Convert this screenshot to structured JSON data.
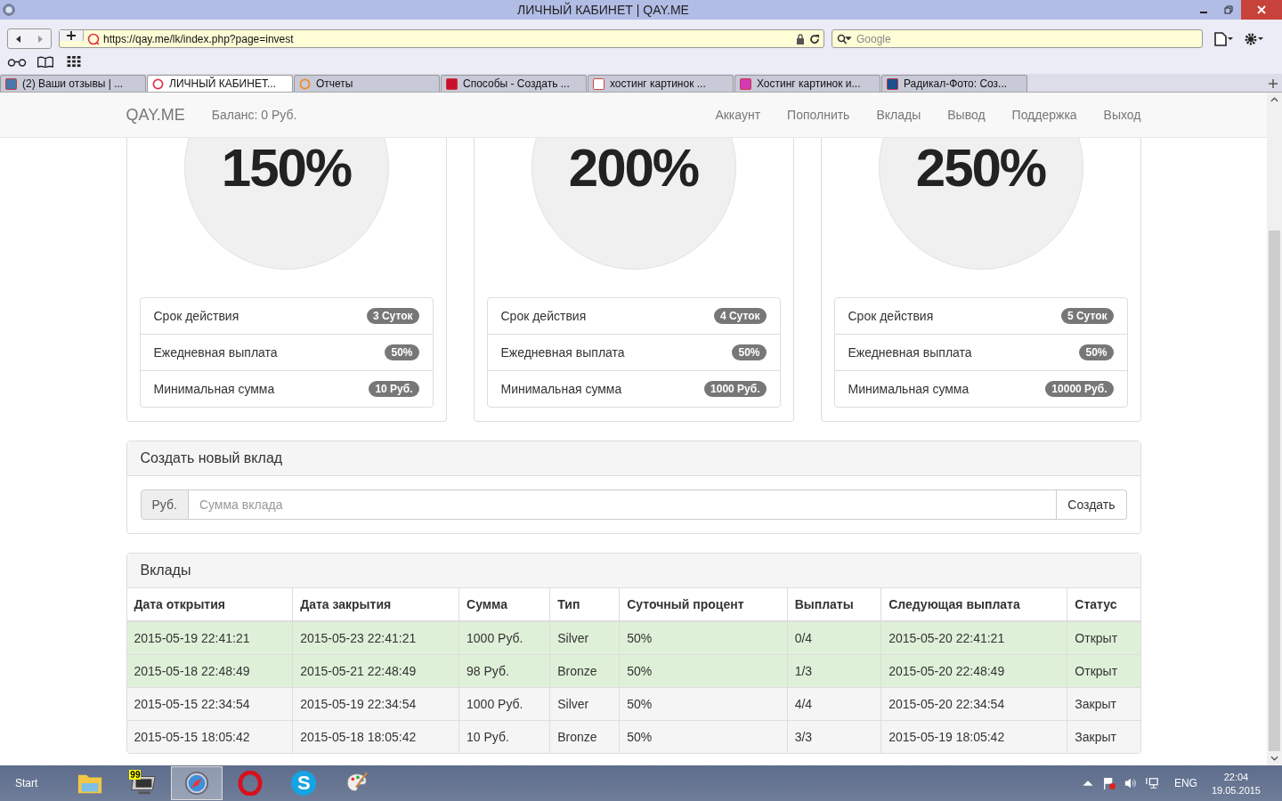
{
  "window": {
    "title": "ЛИЧНЫЙ КАБИНЕТ | QAY.ME"
  },
  "browser": {
    "address": "https://qay.me/lk/index.php?page=invest",
    "search_placeholder": "Google",
    "tabs": [
      {
        "label": "(2) Ваши отзывы | ...",
        "kind": "vk",
        "selected": false
      },
      {
        "label": "ЛИЧНЫЙ КАБИНЕТ...",
        "kind": "ring-red",
        "selected": true
      },
      {
        "label": "Отчеты",
        "kind": "ring-orange",
        "selected": false
      },
      {
        "label": "Способы - Создать ...",
        "kind": "square-red",
        "selected": false
      },
      {
        "label": "хостинг картинок ...",
        "kind": "ya",
        "selected": false
      },
      {
        "label": "Хостинг картинок и...",
        "kind": "k",
        "selected": false
      },
      {
        "label": "Радикал-Фото: Соз...",
        "kind": "r",
        "selected": false
      }
    ]
  },
  "navbar": {
    "brand": "QAY.ME",
    "balance": "Баланс: 0 Руб.",
    "links": [
      "Аккаунт",
      "Пополнить",
      "Вклады",
      "Вывод",
      "Поддержка",
      "Выход"
    ]
  },
  "plans": [
    {
      "percent": "150%",
      "rows": [
        {
          "label": "Срок действия",
          "badge": "3 Суток"
        },
        {
          "label": "Ежедневная выплата",
          "badge": "50%"
        },
        {
          "label": "Минимальная сумма",
          "badge": "10 Руб."
        }
      ]
    },
    {
      "percent": "200%",
      "rows": [
        {
          "label": "Срок действия",
          "badge": "4 Суток"
        },
        {
          "label": "Ежедневная выплата",
          "badge": "50%"
        },
        {
          "label": "Минимальная сумма",
          "badge": "1000 Руб."
        }
      ]
    },
    {
      "percent": "250%",
      "rows": [
        {
          "label": "Срок действия",
          "badge": "5 Суток"
        },
        {
          "label": "Ежедневная выплата",
          "badge": "50%"
        },
        {
          "label": "Минимальная сумма",
          "badge": "10000 Руб."
        }
      ]
    }
  ],
  "new_deposit": {
    "title": "Создать новый вклад",
    "addon": "Руб.",
    "placeholder": "Сумма вклада",
    "button": "Создать"
  },
  "deposits": {
    "title": "Вклады",
    "columns": [
      "Дата открытия",
      "Дата закрытия",
      "Сумма",
      "Тип",
      "Суточный процент",
      "Выплаты",
      "Следующая выплата",
      "Статус"
    ],
    "rows": [
      {
        "highlighted": true,
        "cells": [
          "2015-05-19 22:41:21",
          "2015-05-23 22:41:21",
          "1000 Руб.",
          "Silver",
          "50%",
          "0/4",
          "2015-05-20 22:41:21",
          "Открыт"
        ]
      },
      {
        "highlighted": true,
        "cells": [
          "2015-05-18 22:48:49",
          "2015-05-21 22:48:49",
          "98 Руб.",
          "Bronze",
          "50%",
          "1/3",
          "2015-05-20 22:48:49",
          "Открыт"
        ]
      },
      {
        "highlighted": false,
        "cells": [
          "2015-05-15 22:34:54",
          "2015-05-19 22:34:54",
          "1000 Руб.",
          "Silver",
          "50%",
          "4/4",
          "2015-05-20 22:34:54",
          "Закрыт"
        ]
      },
      {
        "highlighted": false,
        "cells": [
          "2015-05-15 18:05:42",
          "2015-05-18 18:05:42",
          "10 Руб.",
          "Bronze",
          "50%",
          "3/3",
          "2015-05-19 18:05:42",
          "Закрыт"
        ]
      }
    ]
  },
  "taskbar": {
    "start": "Start",
    "apps": [
      {
        "kind": "folder",
        "selected": false
      },
      {
        "kind": "monitor",
        "selected": false
      },
      {
        "kind": "compass",
        "selected": true
      },
      {
        "kind": "opera",
        "selected": false
      },
      {
        "kind": "skype",
        "selected": false
      },
      {
        "kind": "paint",
        "selected": false
      }
    ],
    "counter": "99",
    "skype_letter": "S",
    "language": "ENG",
    "time": "22:04",
    "date": "19.05.2015"
  }
}
